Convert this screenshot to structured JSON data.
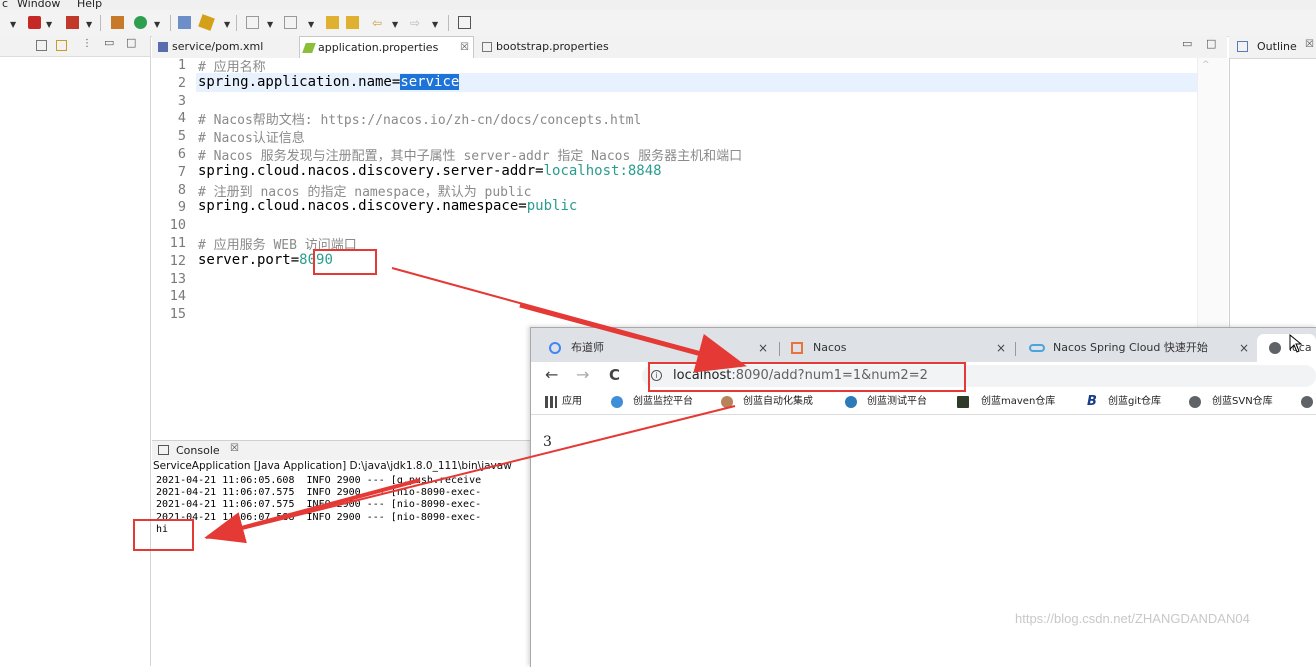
{
  "menu": {
    "items": [
      "Window",
      "Help"
    ]
  },
  "editor": {
    "tabs": [
      {
        "label": "service/pom.xml"
      },
      {
        "label": "application.properties",
        "close": "☒"
      },
      {
        "label": "bootstrap.properties"
      }
    ],
    "lines": [
      {
        "n": "1",
        "comment": "# 应用名称"
      },
      {
        "n": "2",
        "key": "spring.application.name",
        "eq": "=",
        "value": "service"
      },
      {
        "n": "3"
      },
      {
        "n": "4",
        "comment": "# Nacos帮助文档: https://nacos.io/zh-cn/docs/concepts.html"
      },
      {
        "n": "5",
        "comment": "# Nacos认证信息"
      },
      {
        "n": "6",
        "comment": "# Nacos 服务发现与注册配置，其中子属性 server-addr 指定 Nacos 服务器主机和端口"
      },
      {
        "n": "7",
        "key": "spring.cloud.nacos.discovery.server-addr",
        "eq": "=",
        "value": "localhost:8848"
      },
      {
        "n": "8",
        "comment": "# 注册到 nacos 的指定 namespace，默认为 public"
      },
      {
        "n": "9",
        "key": "spring.cloud.nacos.discovery.namespace",
        "eq": "=",
        "value": "public"
      },
      {
        "n": "10"
      },
      {
        "n": "11",
        "comment": "# 应用服务 WEB 访问端口"
      },
      {
        "n": "12",
        "key": "server.port",
        "eq": "=",
        "value": "8090"
      },
      {
        "n": "13"
      },
      {
        "n": "14"
      },
      {
        "n": "15"
      }
    ]
  },
  "outline": {
    "label": "Outline"
  },
  "console": {
    "tab_label": "Console",
    "tab_close": "☒",
    "header": "ServiceApplication [Java Application] D:\\java\\jdk1.8.0_111\\bin\\javaw",
    "lines": [
      "2021-04-21 11:06:05.608  INFO 2900 --- [g.push.receive",
      "2021-04-21 11:06:07.575  INFO 2900 --- [nio-8090-exec-",
      "2021-04-21 11:06:07.575  INFO 2900 --- [nio-8090-exec-",
      "2021-04-21 11:06:07.588  INFO 2900 --- [nio-8090-exec-",
      "hi"
    ]
  },
  "browser": {
    "tabs": [
      {
        "label": "布道师",
        "close": "×"
      },
      {
        "label": "Nacos",
        "close": "×"
      },
      {
        "label": "Nacos Spring Cloud 快速开始",
        "close": "×"
      },
      {
        "label": "loca"
      }
    ],
    "nav": {
      "back": "←",
      "forward": "→",
      "reload": "C"
    },
    "url": {
      "host": "localhost",
      "rest": ":8090/add?num1=1&num2=2"
    },
    "bookmarks": [
      {
        "label": "应用"
      },
      {
        "label": "创蓝监控平台"
      },
      {
        "label": "创蓝自动化集成"
      },
      {
        "label": "创蓝测试平台"
      },
      {
        "label": "创蓝maven仓库"
      },
      {
        "label": "创蓝git仓库"
      },
      {
        "label": "创蓝SVN仓库"
      }
    ],
    "content": "3"
  },
  "watermark": "https://blog.csdn.net/ZHANGDANDAN04",
  "colors": {
    "annotation": "#e53935",
    "selection": "#1e73d9",
    "value_text": "#2a9d8f"
  }
}
